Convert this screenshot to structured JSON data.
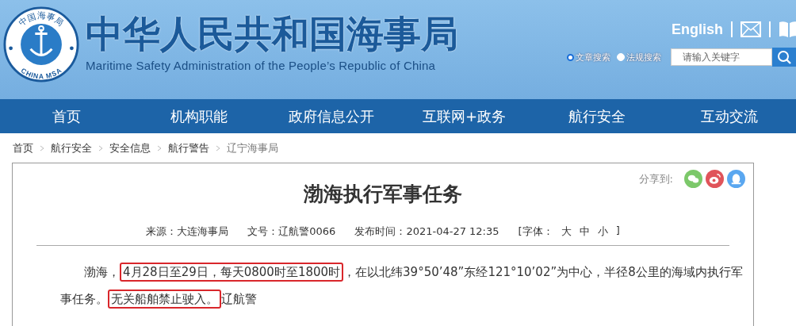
{
  "header": {
    "logo": {
      "arc_text": "中国海事局",
      "band_text": "CHINA MSA"
    },
    "title": "中华人民共和国海事局",
    "subtitle": "Maritime Safety Administration of the People’s Republic of China",
    "language_link": "English",
    "search_scopes": [
      {
        "label": "文章搜索",
        "selected": true
      },
      {
        "label": "法规搜索",
        "selected": false
      }
    ],
    "search": {
      "placeholder": "请输入关键字"
    }
  },
  "nav": [
    {
      "label": "首页"
    },
    {
      "label": "机构职能"
    },
    {
      "label": "政府信息公开"
    },
    {
      "label": "互联网+政务"
    },
    {
      "label": "航行安全"
    },
    {
      "label": "互动交流"
    }
  ],
  "breadcrumb": [
    "首页",
    "航行安全",
    "安全信息",
    "航行警告",
    "辽宁海事局"
  ],
  "article": {
    "share_label": "分享到:",
    "title": "渤海执行军事任务",
    "meta": {
      "source": "来源：大连海事局",
      "number": "文号：辽航警0066",
      "published": "发布时间：2021-04-27 12:35",
      "font_label": "[字体：",
      "font_sizes": [
        "大",
        "中",
        "小"
      ],
      "font_close": "]"
    },
    "body": [
      {
        "text": "渤海，",
        "highlighted": false
      },
      {
        "text": "4月28日至29日，每天0800时至1800时",
        "highlighted": true
      },
      {
        "text": "，在以北纬39°50’48”东经121°10’02”为中心，半径8公里的海域内执行军事任务。",
        "highlighted": false
      },
      {
        "text": "无关船舶禁止驶入。",
        "highlighted": true
      },
      {
        "text": "辽航警",
        "highlighted": false
      }
    ]
  }
}
